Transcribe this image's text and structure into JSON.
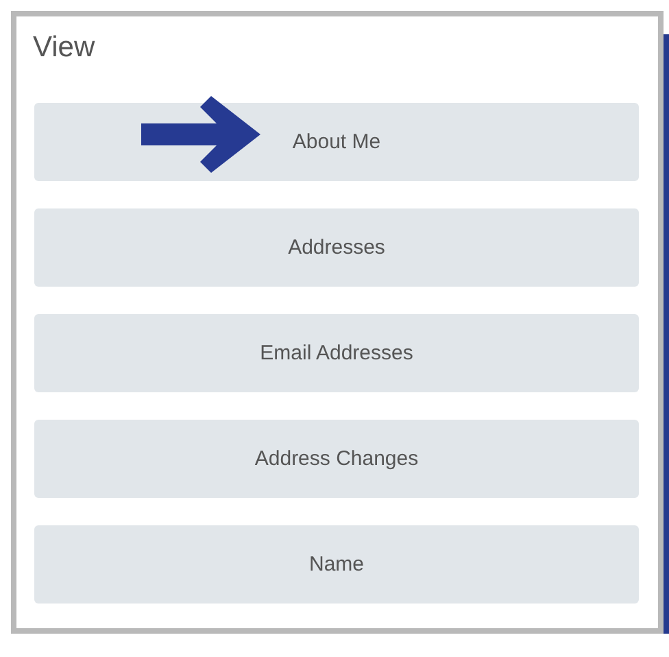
{
  "panel": {
    "title": "View"
  },
  "buttons": [
    {
      "label": "About Me",
      "pointed_at": true
    },
    {
      "label": "Addresses",
      "pointed_at": false
    },
    {
      "label": "Email Addresses",
      "pointed_at": false
    },
    {
      "label": "Address Changes",
      "pointed_at": false
    },
    {
      "label": "Name",
      "pointed_at": false
    }
  ]
}
